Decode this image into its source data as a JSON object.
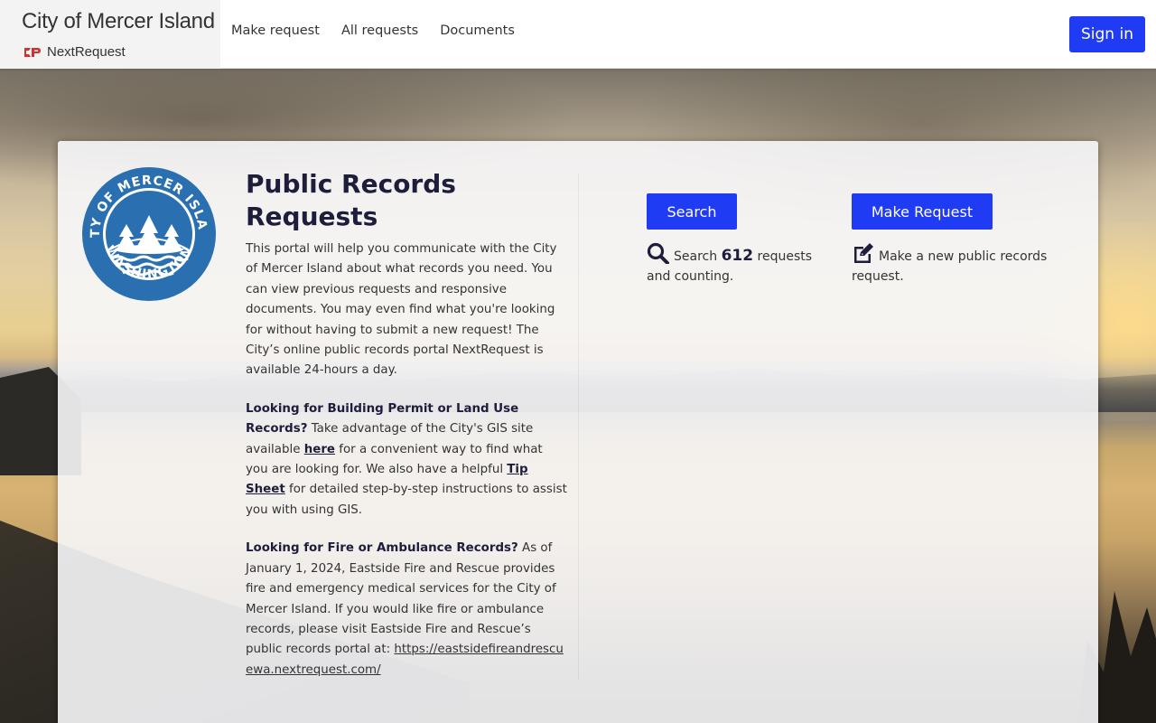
{
  "header": {
    "brand_title": "City of Mercer Island",
    "brand_sub": "NextRequest",
    "nav": [
      "Make request",
      "All requests",
      "Documents"
    ],
    "signin_label": "Sign in"
  },
  "seal": {
    "top_text": "CITY OF MERCER ISLAND",
    "bottom_text": "WASHINGTON"
  },
  "main": {
    "title": "Public Records Requests",
    "intro": "This portal will help you communicate with the City of Mercer Island about what records you need. You can view previous requests and responsive documents. You may even find what you're looking for without having to submit a new request! The City’s online public records portal NextRequest is available 24-hours a day.",
    "gis_heading": "Looking for Building Permit or Land Use Records?",
    "gis_text_1": " Take advantage of the City's GIS site available ",
    "gis_link_here": "here",
    "gis_text_2": " for a convenient way to find what you are looking for. We also have a helpful ",
    "gis_link_tip": "Tip Sheet",
    "gis_text_3": " for detailed step-by-step instructions to assist you with using GIS.",
    "fire_heading": "Looking for Fire or Ambulance Records?",
    "fire_text": " As of January 1, 2024, Eastside Fire and Rescue provides fire and emergency medical services for the City of Mercer Island. If you would like fire or ambulance records, please visit Eastside Fire and Rescue’s public records portal at: ",
    "fire_link": "https://eastsidefireandrescuewa.nextrequest.com/"
  },
  "actions": {
    "search_label": "Search",
    "search_info_prefix": "Search ",
    "search_count": "612",
    "search_info_suffix": " requests and counting.",
    "make_label": "Make Request",
    "make_info": "Make a new public records request."
  },
  "colors": {
    "accent": "#1f3bf3",
    "seal_blue": "#2a6fb0",
    "title": "#1e1e3c"
  },
  "icons": {
    "search": "magnifier-icon",
    "make": "edit-icon"
  }
}
